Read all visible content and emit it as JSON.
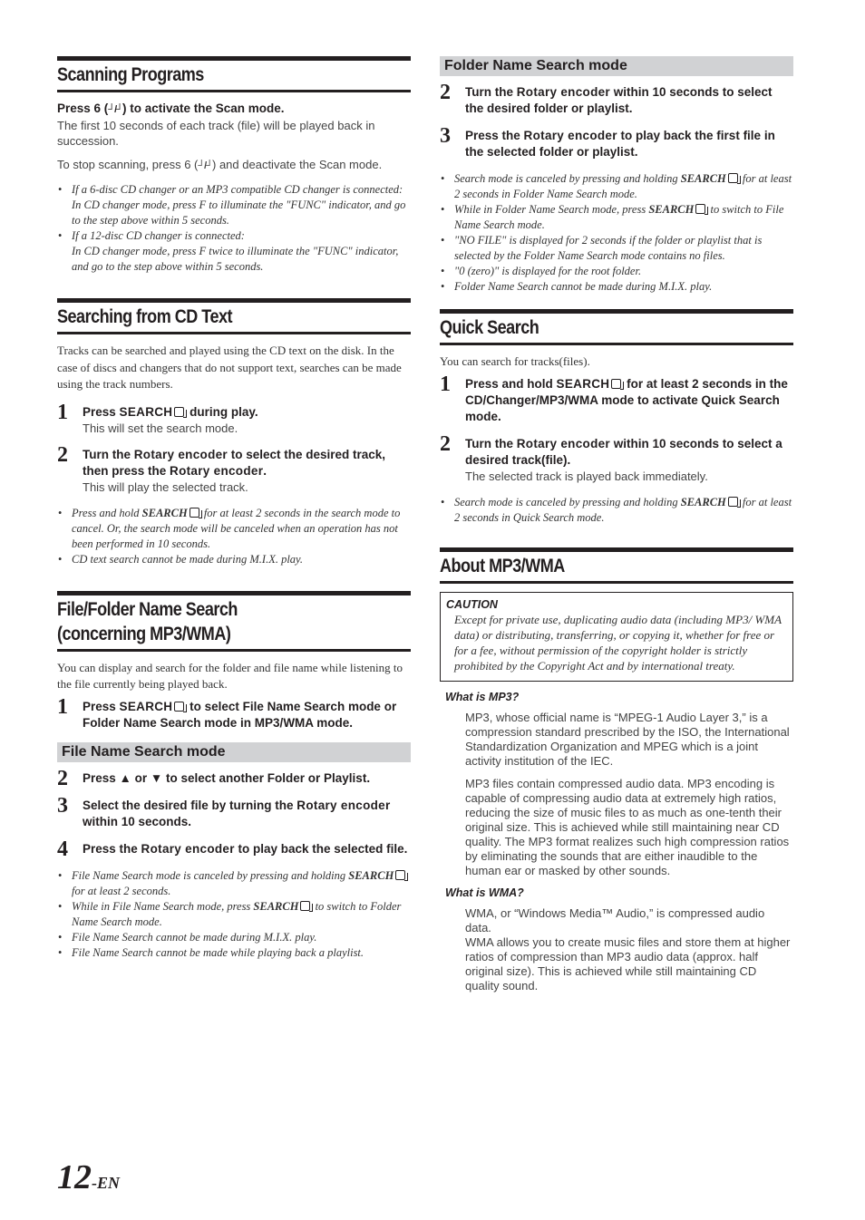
{
  "left": {
    "scanning": {
      "title": "Scanning Programs",
      "lead_pre": "Press 6 (",
      "scan_icon": "scan-icon",
      "lead_post": ") to activate the Scan mode.",
      "lead_desc": "The first 10 seconds of each track (file) will be played back in succession.",
      "stop_pre": "To stop scanning, press 6 (",
      "stop_post": ") and deactivate the Scan mode.",
      "notes": [
        "If a 6-disc CD changer or an MP3 compatible CD changer is connected:",
        "In CD changer mode, press F to illuminate the \"FUNC\" indicator, and go to the step above within 5 seconds.",
        "If a 12-disc CD changer is connected:",
        "In CD changer mode, press F twice to illuminate the \"FUNC\" indicator, and go to the step above within 5 seconds."
      ]
    },
    "cdtext": {
      "title": "Searching from CD Text",
      "intro": "Tracks can be searched and played using the CD text on the disk. In the case of discs and changers that do not support text, searches can be made using the track numbers.",
      "steps": [
        {
          "num": "1",
          "pre": "Press ",
          "key": "SEARCH",
          "post": " during play.",
          "sub": "This will set the search mode."
        },
        {
          "num": "2",
          "a": "Turn the ",
          "k1": "Rotary encoder",
          "b": " to select the desired track, then press the ",
          "k2": "Rotary encoder",
          "c": ".",
          "sub": "This will play the selected track."
        }
      ],
      "notes": [
        {
          "pre": "Press and hold ",
          "key": "SEARCH",
          "post": " for at least 2 seconds in the search mode to cancel. Or, the search mode will be canceled when an operation has not been performed in 10 seconds."
        },
        {
          "text": "CD text search cannot be made during M.I.X. play."
        }
      ]
    },
    "filefolder": {
      "title_line1": "File/Folder Name Search",
      "title_line2": "(concerning MP3/WMA)",
      "intro": "You can display and search for the folder and file name while listening to the file currently being played back.",
      "step1": {
        "num": "1",
        "pre": "Press ",
        "key": "SEARCH",
        "post": " to select File Name Search mode or Folder Name Search mode in MP3/WMA mode."
      },
      "subhead": "File Name Search mode",
      "steps": [
        {
          "num": "2",
          "text": "Press ▲ or ▼ to select another Folder or Playlist."
        },
        {
          "num": "3",
          "a": "Select the desired file by turning the ",
          "k": "Rotary encoder",
          "b": " within 10 seconds."
        },
        {
          "num": "4",
          "a": "Press the ",
          "k": "Rotary encoder",
          "b": " to play back the selected file."
        }
      ],
      "notes": [
        {
          "pre": "File Name Search mode is canceled by pressing and holding ",
          "key": "SEARCH",
          "post": "  for at least 2 seconds."
        },
        {
          "pre": "While in File Name Search mode, press ",
          "key": "SEARCH",
          "post": " to switch to Folder Name Search mode."
        },
        {
          "text": "File Name Search cannot be made during M.I.X. play."
        },
        {
          "text": "File Name Search cannot be made while playing back a playlist."
        }
      ]
    }
  },
  "right": {
    "folder": {
      "subhead": "Folder Name Search mode",
      "steps": [
        {
          "num": "2",
          "a": "Turn the ",
          "k": "Rotary encoder",
          "b": " within 10 seconds to select the desired folder or playlist."
        },
        {
          "num": "3",
          "a": "Press the ",
          "k": "Rotary encoder",
          "b": " to play back the first file in the selected folder or playlist."
        }
      ],
      "notes": [
        {
          "pre": "Search mode is canceled by pressing and holding ",
          "key": "SEARCH",
          "post": "  for at least 2 seconds in Folder Name Search mode."
        },
        {
          "pre": "While in Folder Name Search mode, press ",
          "key": "SEARCH",
          "post": " to switch to File Name Search mode."
        },
        {
          "text": "\"NO FILE\" is displayed for 2 seconds if the folder or playlist that is selected by the Folder Name Search mode contains no files."
        },
        {
          "text": "\"0 (zero)\" is displayed for the root folder."
        },
        {
          "text": "Folder Name Search cannot be made during M.I.X. play."
        }
      ]
    },
    "quick": {
      "title": "Quick Search",
      "intro": "You can search for tracks(files).",
      "steps": [
        {
          "num": "1",
          "pre": "Press and hold ",
          "key": "SEARCH",
          "post": " for at least 2 seconds in the CD/Changer/MP3/WMA mode to activate Quick Search mode."
        },
        {
          "num": "2",
          "a": "Turn the ",
          "k": "Rotary encoder",
          "b": " within 10 seconds to select a desired track(file).",
          "sub": "The selected track is played back immediately."
        }
      ],
      "notes": [
        {
          "pre": "Search mode is canceled by pressing and holding ",
          "key": "SEARCH",
          "post": " for at least 2 seconds in Quick Search mode."
        }
      ]
    },
    "about": {
      "title": "About MP3/WMA",
      "caution_title": "CAUTION",
      "caution_text": "Except for private use, duplicating audio data (including MP3/ WMA data) or distributing, transferring, or copying it, whether for free or for a fee, without permission of the copyright holder is strictly prohibited by the Copyright Act and by international treaty.",
      "mp3_head": "What is MP3?",
      "mp3_p1": "MP3, whose official name is “MPEG-1 Audio Layer 3,” is a compression standard prescribed by the ISO, the International Standardization Organization and MPEG which is a joint activity institution of the IEC.",
      "mp3_p2": "MP3 files contain compressed audio data. MP3 encoding is capable of compressing audio data at extremely high ratios, reducing the size of music files to as much as one-tenth their original size. This is achieved while still maintaining near CD quality. The MP3 format realizes such high compression ratios by eliminating the sounds that are either inaudible to the human ear or masked by other sounds.",
      "wma_head": "What is WMA?",
      "wma_p1": "WMA, or “Windows Media™ Audio,” is compressed audio data.",
      "wma_p2": "WMA allows you to create music files and store them at higher ratios of compression than MP3 audio data (approx. half original size). This is achieved while still maintaining CD quality sound."
    }
  },
  "footer": {
    "page_number": "12",
    "page_suffix": "-EN"
  }
}
